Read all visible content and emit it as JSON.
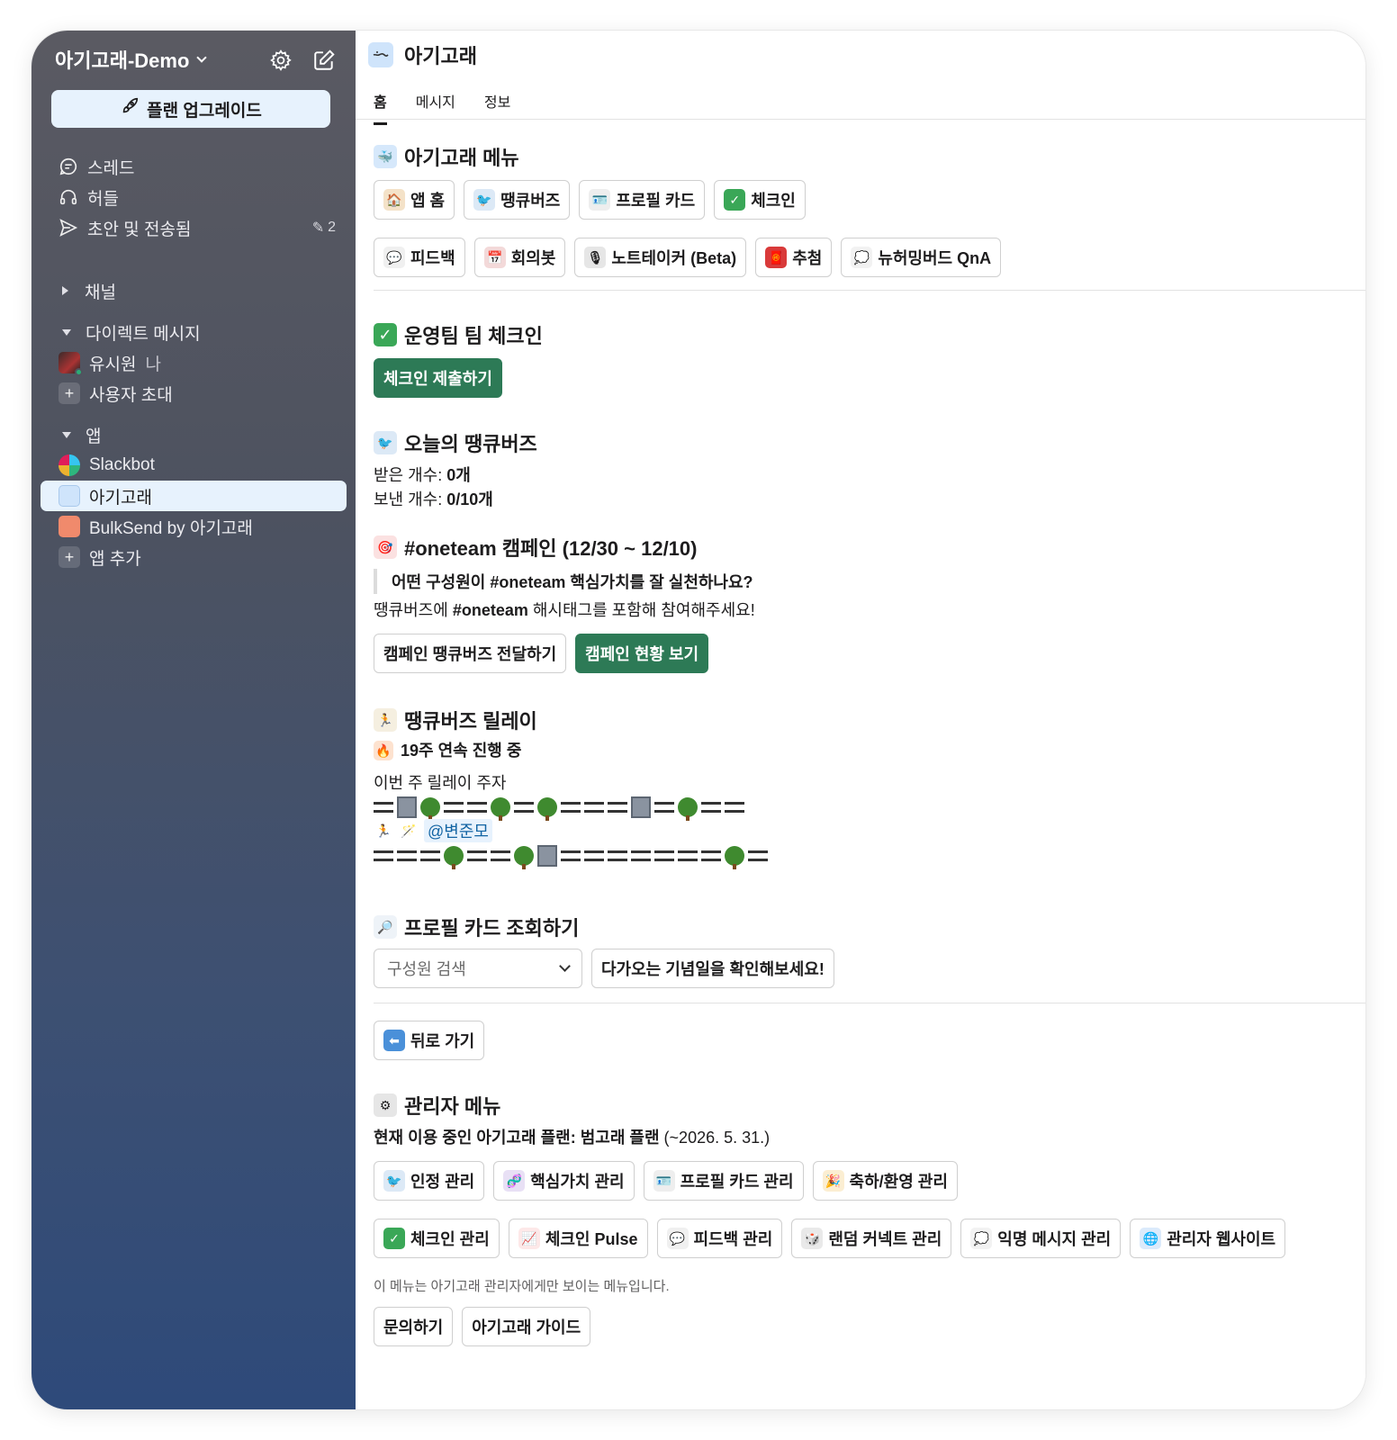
{
  "sidebar": {
    "workspace_name": "아기고래-Demo",
    "upgrade_label": "플랜 업그레이드",
    "nav": [
      {
        "label": "스레드",
        "icon": "threads-icon"
      },
      {
        "label": "허들",
        "icon": "headphones-icon"
      },
      {
        "label": "초안 및 전송됨",
        "icon": "send-icon",
        "badge": "2"
      }
    ],
    "channels_label": "채널",
    "dm_label": "다이렉트 메시지",
    "dm_user": "유시원",
    "dm_user_suffix": "나",
    "invite_label": "사용자 초대",
    "apps_label": "앱",
    "apps": [
      "Slackbot",
      "아기고래",
      "BulkSend by 아기고래"
    ],
    "add_app_label": "앱 추가"
  },
  "header": {
    "app_name": "아기고래",
    "tabs": [
      "홈",
      "메시지",
      "정보"
    ]
  },
  "menu": {
    "title": "아기고래 메뉴",
    "row1": [
      "앱 홈",
      "땡큐버즈",
      "프로필 카드",
      "체크인"
    ],
    "row2": [
      "피드백",
      "회의봇",
      "노트테이커 (Beta)",
      "추첨",
      "뉴허밍버드 QnA"
    ]
  },
  "checkin": {
    "title": "운영팀 팀 체크인",
    "button": "체크인 제출하기"
  },
  "thanks": {
    "title": "오늘의 땡큐버즈",
    "received_label": "받은 개수:",
    "received_value": "0개",
    "sent_label": "보낸 개수:",
    "sent_value": "0/10개"
  },
  "campaign": {
    "title": "#oneteam 캠페인 (12/30 ~ 12/10)",
    "quote": "어떤 구성원이 #oneteam 핵심가치를 잘 실천하나요?",
    "desc_pre": "땡큐버즈에 ",
    "desc_tag": "#oneteam",
    "desc_post": " 해시태그를 포함해 참여해주세요!",
    "btn_send": "캠페인 땡큐버즈 전달하기",
    "btn_status": "캠페인 현황 보기"
  },
  "relay": {
    "title": "땡큐버즈 릴레이",
    "streak": "19주 연속 진행 중",
    "runner_label": "이번 주 릴레이 주자",
    "mention": "@변준모"
  },
  "profile": {
    "title": "프로필 카드 조회하기",
    "search_placeholder": "구성원 검색",
    "anniv_button": "다가오는 기념일을 확인해보세요!",
    "back_button": "뒤로 가기"
  },
  "admin": {
    "title": "관리자 메뉴",
    "plan_label": "현재 이용 중인 아기고래 플랜: 범고래 플랜",
    "plan_until": "(~2026. 5. 31.)",
    "row1": [
      "인정 관리",
      "핵심가치 관리",
      "프로필 카드 관리",
      "축하/환영 관리"
    ],
    "row2": [
      "체크인 관리",
      "체크인 Pulse",
      "피드백 관리",
      "랜덤 커넥트 관리",
      "익명 메시지 관리",
      "관리자 웹사이트"
    ],
    "note": "이 메뉴는 아기고래 관리자에게만 보이는 메뉴입니다.",
    "footer_buttons": [
      "문의하기",
      "아기고래 가이드"
    ]
  },
  "colors": {
    "accent_green": "#2d7a56",
    "active_bg": "#e7f2fd",
    "mention_blue": "#1264a3"
  }
}
